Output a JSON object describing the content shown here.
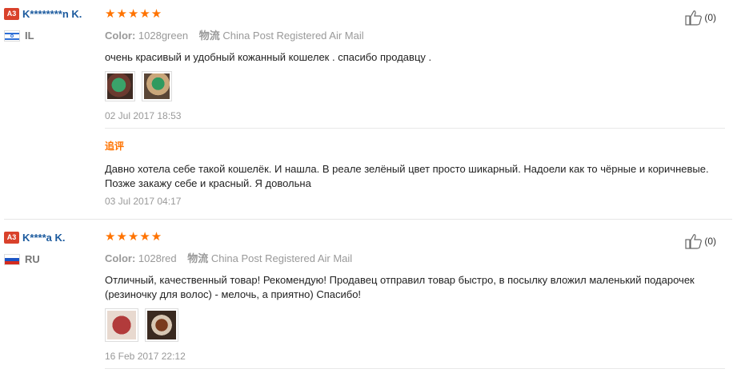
{
  "reviews": [
    {
      "level": "A3",
      "user": "K********n K.",
      "country": "IL",
      "stars": "★★★★★",
      "color_label": "Color:",
      "color_value": "1028green",
      "ship_label": "物流",
      "ship_value": "China Post Registered Air Mail",
      "text": "очень красивый и удобный кожанный кошелек . спасибо продавцу .",
      "photos": 2,
      "date": "02 Jul 2017 18:53",
      "additional": {
        "title": "追评",
        "text": "Давно хотела себе такой кошелёк. И нашла. В реале зелёный цвет просто шикарный. Надоели как то чёрные и коричневые. Позже закажу себе и красный. Я довольна",
        "date": "03 Jul 2017 04:17"
      },
      "helpful": "(0)"
    },
    {
      "level": "A3",
      "user": "K****a K.",
      "country": "RU",
      "stars": "★★★★★",
      "color_label": "Color:",
      "color_value": "1028red",
      "ship_label": "物流",
      "ship_value": "China Post Registered Air Mail",
      "text": "Отличный, качественный товар! Рекомендую! Продавец отправил товар быстро, в посылку вложил маленький подарочек (резиночку для волос) - мелочь, а приятно) Спасибо!",
      "photos": 2,
      "date": "16 Feb 2017 22:12",
      "helpful": "(0)"
    }
  ],
  "colors": {
    "accent": "#ff7300",
    "username": "#1b5a9e",
    "level_badge": "#d9412b"
  }
}
